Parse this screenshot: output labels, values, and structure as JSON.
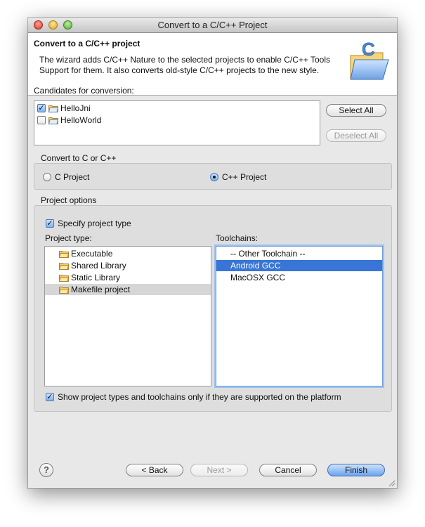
{
  "window": {
    "title": "Convert to a C/C++ Project"
  },
  "banner": {
    "title": "Convert to a C/C++ project",
    "description": "The wizard adds C/C++ Nature to the selected projects to enable C/C++ Tools Support for them. It also converts old-style C/C++ projects to the new style."
  },
  "candidates": {
    "label": "Candidates for conversion:",
    "items": [
      {
        "label": "HelloJni",
        "checked": true
      },
      {
        "label": "HelloWorld",
        "checked": false
      }
    ],
    "select_all": "Select All",
    "deselect_all": "Deselect All"
  },
  "convert": {
    "label": "Convert to C or C++",
    "c_project": "C Project",
    "cpp_project": "C++ Project",
    "selected": "cpp"
  },
  "options": {
    "label": "Project options",
    "specify_type": "Specify project type",
    "project_type_label": "Project type:",
    "project_types": [
      "Executable",
      "Shared Library",
      "Static Library",
      "Makefile project"
    ],
    "selected_project_type": "Makefile project",
    "toolchains_label": "Toolchains:",
    "toolchains": [
      "-- Other Toolchain --",
      "Android GCC",
      "MacOSX GCC"
    ],
    "selected_toolchain": "Android GCC",
    "show_supported": "Show project types and toolchains only if they are supported on the platform"
  },
  "footer": {
    "help_symbol": "?",
    "back": "< Back",
    "next": "Next >",
    "cancel": "Cancel",
    "finish": "Finish"
  },
  "colors": {
    "selection": "#3875d7",
    "default_button": "#6aa3ee"
  }
}
